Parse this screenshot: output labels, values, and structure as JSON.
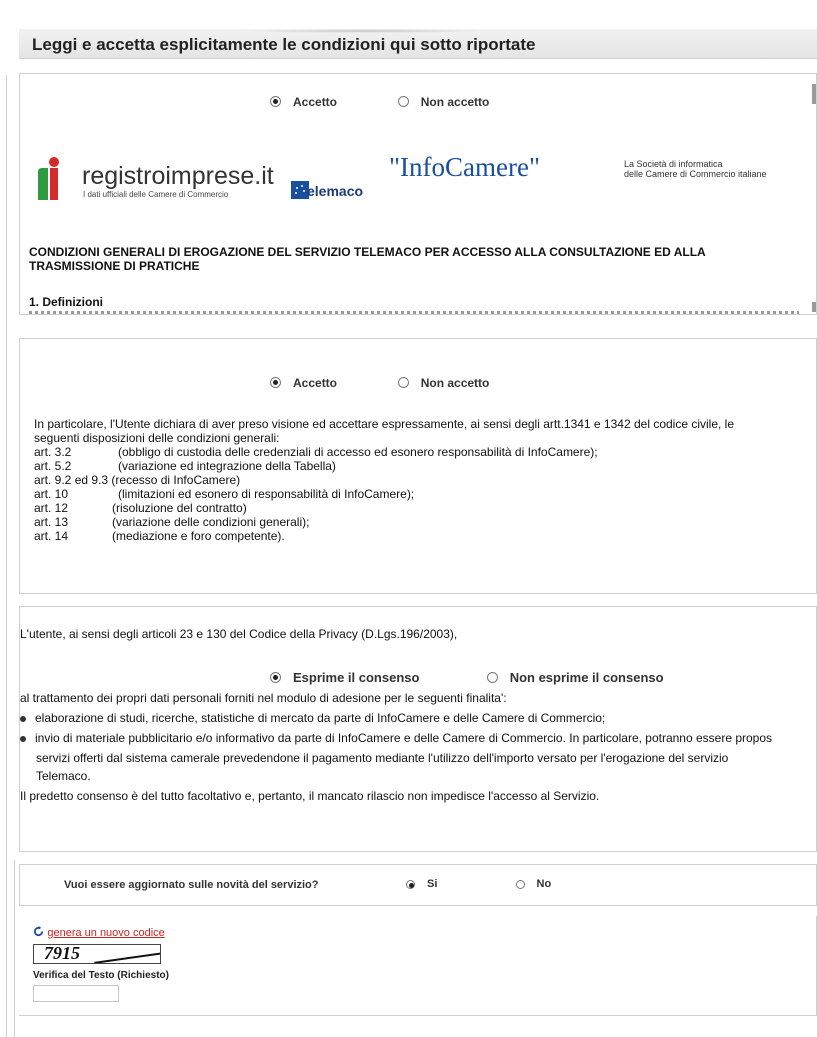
{
  "header": {
    "title": "Leggi e accetta esplicitamente le condizioni qui sotto riportate"
  },
  "section1": {
    "radio_accept": "Accetto",
    "radio_decline": "Non accetto",
    "logos": {
      "registro": "registroimprese.it",
      "registro_tagline": "I dati ufficiali delle Camere di Commercio",
      "telemaco": "Telemaco",
      "infocamere": "\"InfoCamere\"",
      "infocamere_tagline_1": "La Società di informatica",
      "infocamere_tagline_2": "delle Camere di Commercio italiane"
    },
    "heading_1": "CONDIZIONI GENERALI DI EROGAZIONE DEL SERVIZIO TELEMACO PER ACCESSO ALLA CONSULTAZIONE ED ALLA",
    "heading_2": "TRASMISSIONE DI PRATICHE",
    "subheading": "1. Definizioni"
  },
  "section2": {
    "radio_accept": "Accetto",
    "radio_decline": "Non accetto",
    "intro_1": "In particolare, l'Utente dichiara di aver preso visione ed accettare espressamente, ai sensi degli artt.1341 e 1342 del codice civile, le",
    "intro_2": "seguenti disposizioni delle condizioni generali:",
    "articles": [
      {
        "code": "art. 3.2",
        "text": "(obbligo di custodia delle credenziali di accesso ed esonero responsabilità di InfoCamere);"
      },
      {
        "code": "art. 5.2",
        "text": "(variazione ed integrazione della Tabella)"
      },
      {
        "code": "art. 9.2 ed 9.3",
        "text": "(recesso di InfoCamere)"
      },
      {
        "code": "art. 10",
        "text": "(limitazioni ed esonero di responsabilità di InfoCamere);"
      },
      {
        "code": "art. 12",
        "text": "(risoluzione del contratto)"
      },
      {
        "code": "art. 13",
        "text": "(variazione delle condizioni generali);"
      },
      {
        "code": "art. 14",
        "text": "(mediazione e foro competente)."
      }
    ]
  },
  "section3": {
    "intro": "L'utente, ai sensi degli articoli 23 e 130 del Codice della Privacy (D.Lgs.196/2003),",
    "radio_consent": "Esprime il consenso",
    "radio_no_consent": "Non esprime il consenso",
    "purpose": "al trattamento dei propri dati personali forniti nel modulo di adesione per le seguenti finalita':",
    "bullet_1": "elaborazione di studi, ricerche, statistiche di mercato da parte di InfoCamere e delle Camere di Commercio;",
    "bullet_2_line_1": "invio di materiale pubblicitario e/o informativo da parte di InfoCamere e delle Camere di Commercio. In particolare, potranno essere propos",
    "bullet_2_line_2": "servizi offerti dal sistema camerale prevedendone il pagamento mediante l'utilizzo dell'importo versato per l'erogazione del servizio",
    "bullet_2_line_3": "Telemaco.",
    "closing": "Il predetto consenso è del tutto facoltativo e, pertanto, il mancato rilascio non impedisce l'accesso al Servizio."
  },
  "section4": {
    "question": "Vuoi essere aggiornato sulle novità del servizio?",
    "radio_yes": "Si",
    "radio_no": "No"
  },
  "captcha": {
    "regenerate_link": "genera un nuovo codice",
    "image_text": "7915",
    "field_label": "Verifica del Testo (Richiesto)",
    "field_value": ""
  },
  "colors": {
    "link": "#cc2222",
    "refresh_icon": "#1a4fa0",
    "border": "#cfcfcf"
  }
}
